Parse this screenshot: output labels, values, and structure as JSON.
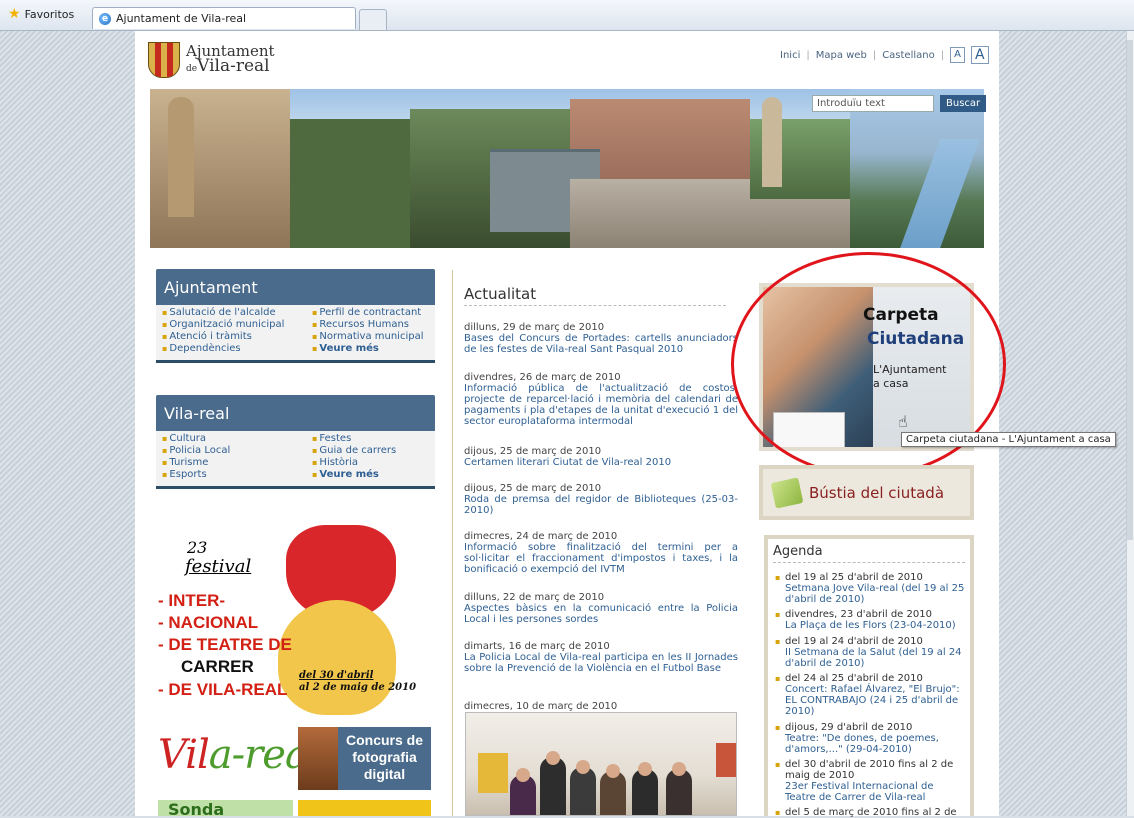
{
  "browser": {
    "favorites_label": "Favoritos",
    "tab_title": "Ajuntament de Vila-real"
  },
  "header": {
    "logo_line1": "Ajuntament",
    "logo_de": "de",
    "logo_line2": "Vila-real",
    "links": {
      "home": "Inici",
      "sitemap": "Mapa web",
      "language": "Castellano",
      "font_small": "A",
      "font_big": "A"
    },
    "search": {
      "placeholder": "Introduïu text",
      "button": "Buscar"
    }
  },
  "left": {
    "ajuntament": {
      "title": "Ajuntament",
      "items": [
        "Salutació de l'alcalde",
        "Perfil de contractant",
        "Organització municipal",
        "Recursos Humans",
        "Atenció i tràmits",
        "Normativa municipal",
        "Dependències",
        "Veure més"
      ]
    },
    "vilareal": {
      "title": "Vila-real",
      "items": [
        "Cultura",
        "Festes",
        "Policia Local",
        "Guia de carrers",
        "Turisme",
        "Història",
        "Esports",
        "Veure més"
      ]
    },
    "poster": {
      "number": "23",
      "festival": "festival",
      "lines": [
        "INTER-",
        "NACIONAL",
        "DE TEATRE DE",
        "CARRER",
        "DE VILA-REAL"
      ],
      "dates1": "del 30 d'abril",
      "dates2": "al 2 de maig de 2010"
    },
    "vila_logo_red": "Vil",
    "vila_logo_green": "a-real",
    "concurs": "Concurs de fotografia digital",
    "bottom_banner": "Sonda"
  },
  "news": {
    "title": "Actualitat",
    "items": [
      {
        "date": "dilluns, 29 de març de 2010",
        "text": "Bases del Concurs de Portades: cartells anunciadors de les festes de Vila-real Sant Pasqual 2010"
      },
      {
        "date": "divendres, 26 de març de 2010",
        "text": "Informació pública de l'actualització de costos, projecte de reparcel·lació i memòria del calendari de pagaments i pla d'etapes de la unitat d'execució 1 del sector europlataforma intermodal"
      },
      {
        "date": "dijous, 25 de març de 2010",
        "text": "Certamen literari Ciutat de Vila-real 2010"
      },
      {
        "date": "dijous, 25 de març de 2010",
        "text": "Roda de premsa del regidor de Biblioteques (25-03-2010)"
      },
      {
        "date": "dimecres, 24 de març de 2010",
        "text": "Informació sobre finalització del termini per a sol·licitar el fraccionament d'impostos i taxes, i la bonificació o exempció del IVTM"
      },
      {
        "date": "dilluns, 22 de març de 2010",
        "text": "Aspectes bàsics en la comunicació entre la Policia Local i les persones sordes"
      },
      {
        "date": "dimarts, 16 de març de 2010",
        "text": "La Policia Local de Vila-real participa en les II Jornades sobre la Prevenció de la Violència en el Futbol Base"
      },
      {
        "date": "dimecres, 10 de març de 2010",
        "text": ""
      }
    ]
  },
  "right": {
    "carpeta": {
      "title1": "Carpeta",
      "title2": "Ciutadana",
      "sub1": "L'Ajuntament",
      "sub2": "a casa"
    },
    "tooltip": "Carpeta ciutadana - L'Ajuntament a casa",
    "bustia": "Bústia del ciutadà",
    "agenda": {
      "title": "Agenda",
      "items": [
        {
          "head": "del 19 al 25 d'abril de 2010",
          "text": "Setmana Jove Vila-real (del 19 al 25 d'abril de 2010)"
        },
        {
          "head": "divendres, 23 d'abril de 2010",
          "text": "La Plaça de les Flors (23-04-2010)"
        },
        {
          "head": "del 19 al 24 d'abril de 2010",
          "text": "II Setmana de la Salut (del 19 al 24 d'abril de 2010)"
        },
        {
          "head": "del 24 al 25 d'abril de 2010",
          "text": "Concert: Rafael Álvarez, \"El Brujo\": EL CONTRABAJO (24 i 25 d'abril de 2010)"
        },
        {
          "head": "dijous, 29 d'abril de 2010",
          "text": "Teatre: \"De dones, de poemes, d'amors,...\" (29-04-2010)"
        },
        {
          "head": "del 30 d'abril de 2010 fins al 2 de maig de 2010",
          "text": "23er Festival Internacional de Teatre de Carrer de Vila-real"
        },
        {
          "head": "del 5 de març de 2010 fins al 2 de",
          "text": ""
        }
      ]
    }
  },
  "colors": {
    "accent": "#4a6b8b",
    "link": "#2e5f92",
    "highlight_circle": "#e0141b"
  }
}
